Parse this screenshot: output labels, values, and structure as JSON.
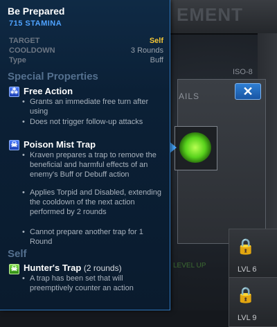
{
  "tooltip": {
    "title": "Be Prepared",
    "stamina": "715 STAMINA",
    "rows": [
      {
        "label": "TARGET",
        "value": "Self"
      },
      {
        "label": "COOLDOWN",
        "value": "3 Rounds"
      },
      {
        "label": "Type",
        "value": "Buff"
      }
    ],
    "special_heading": "Special Properties",
    "properties": [
      {
        "icon": "free-action-icon",
        "title": "Free Action",
        "bullets": [
          "Grants an immediate free turn after using",
          "Does not trigger follow-up attacks"
        ]
      },
      {
        "icon": "trap-icon",
        "title": "Poison Mist Trap",
        "bullets": [
          "Kraven prepares a trap to remove the beneficial and harmful effects of an enemy's Buff or Debuff action",
          "Applies Torpid and Disabled, extending the cooldown of the next action performed by 2 rounds",
          "Cannot prepare another trap for 1 Round"
        ]
      }
    ],
    "self_heading": "Self",
    "self_effect": {
      "icon": "hunters-trap-icon",
      "title": "Hunter's Trap",
      "duration": "(2 rounds)",
      "bullets": [
        "A trap has been set that will preemptively counter an action"
      ]
    }
  },
  "background": {
    "title": "EMENT",
    "iso_label": "ISO-8",
    "details_label": "AILS",
    "close_glyph": "✕",
    "slots": [
      {
        "level": "LVL 6"
      },
      {
        "level": "LVL 9"
      }
    ],
    "footer_text": "LEVEL UP"
  },
  "colors": {
    "accent_blue": "#4fa3ff",
    "self_gold": "#f4c636",
    "panel_bg": "#0b2036"
  }
}
